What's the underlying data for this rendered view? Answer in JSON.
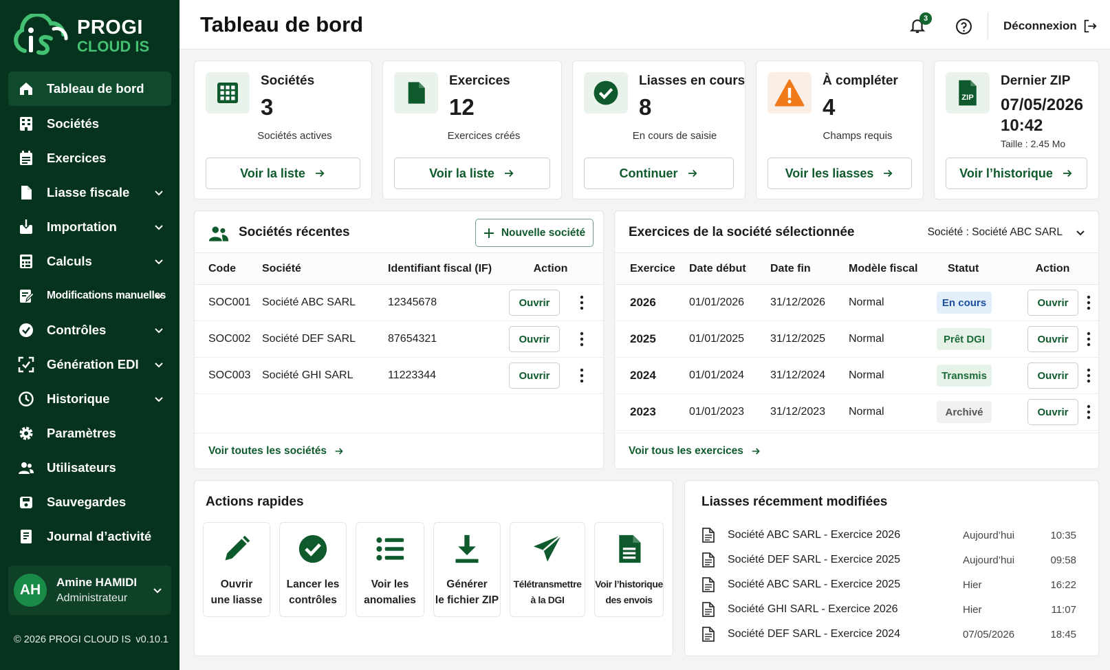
{
  "brand": {
    "line1": "PROGI",
    "line2": "CLOUD IS"
  },
  "nav": [
    {
      "label": "Tableau de bord",
      "icon": "home-icon",
      "active": true,
      "chevron": false
    },
    {
      "label": "Sociétés",
      "icon": "building-icon",
      "chevron": false
    },
    {
      "label": "Exercices",
      "icon": "calendar-icon",
      "chevron": false
    },
    {
      "label": "Liasse fiscale",
      "icon": "file-icon",
      "chevron": true
    },
    {
      "label": "Importation",
      "icon": "import-icon",
      "chevron": true
    },
    {
      "label": "Calculs",
      "icon": "calculator-icon",
      "chevron": true
    },
    {
      "label": "Modifications manuelles",
      "icon": "edit-icon",
      "chevron": true
    },
    {
      "label": "Contrôles",
      "icon": "check-circle-icon",
      "chevron": true
    },
    {
      "label": "Génération EDI",
      "icon": "scan-icon",
      "chevron": true
    },
    {
      "label": "Historique",
      "icon": "clock-icon",
      "chevron": true
    },
    {
      "label": "Paramètres",
      "icon": "gear-icon",
      "chevron": false
    },
    {
      "label": "Utilisateurs",
      "icon": "users-icon",
      "chevron": false
    },
    {
      "label": "Sauvegardes",
      "icon": "save-icon",
      "chevron": false
    },
    {
      "label": "Journal d’activité",
      "icon": "journal-icon",
      "chevron": false
    }
  ],
  "user": {
    "initials": "AH",
    "name": "Amine HAMIDI",
    "role": "Administrateur"
  },
  "footer": {
    "copyright": "© 2026 PROGI CLOUD IS",
    "version": "v0.10.1"
  },
  "header": {
    "title": "Tableau de bord",
    "notif_count": "3",
    "logout": "Déconnexion"
  },
  "stats": [
    {
      "title": "Sociétés",
      "value": "3",
      "sub": "Sociétés actives",
      "button": "Voir la liste",
      "icon": "grid-icon"
    },
    {
      "title": "Exercices",
      "value": "12",
      "sub": "Exercices créés",
      "button": "Voir la liste",
      "icon": "document-icon"
    },
    {
      "title": "Liasses en cours",
      "value": "8",
      "sub": "En cours de saisie",
      "button": "Continuer",
      "icon": "check-circle-icon"
    },
    {
      "title": "À compléter",
      "value": "4",
      "sub": "Champs requis",
      "button": "Voir les liasses",
      "icon": "warning-icon"
    },
    {
      "title": "Dernier ZIP",
      "value": "07/05/2026",
      "value2": "10:42",
      "sub": "Taille : 2.45 Mo",
      "button": "Voir l’historique",
      "icon": "zip-file-icon"
    }
  ],
  "recent": {
    "title": "Sociétés récentes",
    "new_button": "Nouvelle société",
    "columns": [
      "Code",
      "Société",
      "Identifiant fiscal (IF)",
      "Action"
    ],
    "rows": [
      {
        "code": "SOC001",
        "name": "Société ABC SARL",
        "if": "12345678",
        "action": "Ouvrir"
      },
      {
        "code": "SOC002",
        "name": "Société DEF SARL",
        "if": "87654321",
        "action": "Ouvrir"
      },
      {
        "code": "SOC003",
        "name": "Société GHI SARL",
        "if": "11223344",
        "action": "Ouvrir"
      }
    ],
    "link": "Voir toutes les sociétés"
  },
  "exercices": {
    "title": "Exercices de la société sélectionnée",
    "selector": "Société : Société ABC SARL",
    "columns": [
      "Exercice",
      "Date début",
      "Date fin",
      "Modèle fiscal",
      "Statut",
      "Action"
    ],
    "rows": [
      {
        "year": "2026",
        "start": "01/01/2026",
        "end": "31/12/2026",
        "model": "Normal",
        "status": "En cours",
        "status_bg": "#e3eefb",
        "status_fg": "#1b4fa0",
        "action": "Ouvrir"
      },
      {
        "year": "2025",
        "start": "01/01/2025",
        "end": "31/12/2025",
        "model": "Normal",
        "status": "Prêt DGI",
        "status_bg": "#e6f2e8",
        "status_fg": "#1b6b35",
        "action": "Ouvrir"
      },
      {
        "year": "2024",
        "start": "01/01/2024",
        "end": "31/12/2024",
        "model": "Normal",
        "status": "Transmis",
        "status_bg": "#e6f2e8",
        "status_fg": "#1b6b35",
        "action": "Ouvrir"
      },
      {
        "year": "2023",
        "start": "01/01/2023",
        "end": "31/12/2023",
        "model": "Normal",
        "status": "Archivé",
        "status_bg": "#f0f1f0",
        "status_fg": "#555555",
        "action": "Ouvrir"
      }
    ],
    "link": "Voir tous les exercices"
  },
  "quick": {
    "title": "Actions rapides",
    "items": [
      {
        "l1": "Ouvrir",
        "l2": "une liasse",
        "icon": "pencil-icon"
      },
      {
        "l1": "Lancer les",
        "l2": "contrôles",
        "icon": "check-circle-icon"
      },
      {
        "l1": "Voir les",
        "l2": "anomalies",
        "icon": "list-icon"
      },
      {
        "l1": "Générer",
        "l2": "le fichier ZIP",
        "icon": "download-icon"
      },
      {
        "l1": "Télétransmettre",
        "l2": "à la DGI",
        "icon": "send-icon"
      },
      {
        "l1": "Voir l’historique",
        "l2": "des envois",
        "icon": "document-icon"
      }
    ]
  },
  "liasses": {
    "title": "Liasses récemment modifiées",
    "rows": [
      {
        "text": "Société ABC SARL - Exercice 2026",
        "date": "Aujourd’hui",
        "time": "10:35"
      },
      {
        "text": "Société DEF SARL - Exercice 2025",
        "date": "Aujourd’hui",
        "time": "09:58"
      },
      {
        "text": "Société ABC SARL - Exercice 2025",
        "date": "Hier",
        "time": "16:22"
      },
      {
        "text": "Société GHI SARL - Exercice 2026",
        "date": "Hier",
        "time": "11:07"
      },
      {
        "text": "Société DEF SARL - Exercice 2024",
        "date": "07/05/2026",
        "time": "18:45"
      }
    ]
  },
  "colors": {
    "sidebar": "#06331d",
    "accent": "#0f5a2d",
    "brand_green": "#43c071",
    "warning": "#f07a1a"
  }
}
